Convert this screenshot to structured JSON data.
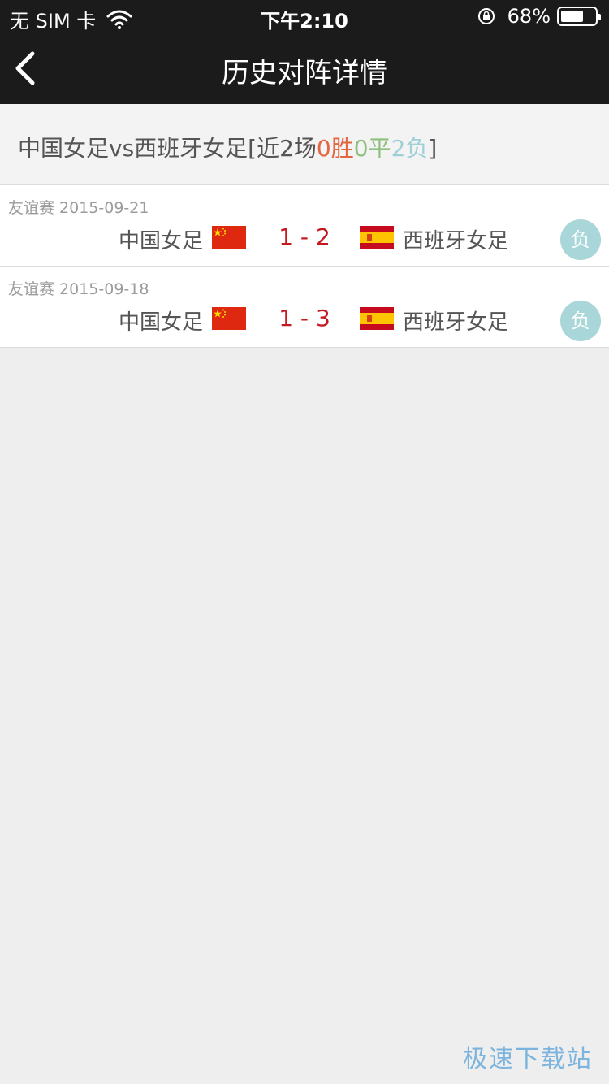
{
  "status_bar": {
    "carrier": "无 SIM 卡",
    "time": "下午2:10",
    "battery": "68%",
    "battery_level": 0.68
  },
  "header": {
    "title": "历史对阵详情"
  },
  "summary": {
    "matchup": "中国女足vs西班牙女足[近2场",
    "wins": "0胜",
    "draws": "0平",
    "losses": "2负",
    "close": "]"
  },
  "matches": [
    {
      "competition_date": "友谊赛 2015-09-21",
      "home": "中国女足",
      "score": "1 - 2",
      "away": "西班牙女足",
      "result": "负"
    },
    {
      "competition_date": "友谊赛 2015-09-18",
      "home": "中国女足",
      "score": "1 - 3",
      "away": "西班牙女足",
      "result": "负"
    }
  ],
  "watermark": "极速下载站",
  "colors": {
    "bar_bg": "#1b1b1b",
    "win": "#e2663f",
    "draw": "#8fbf7f",
    "loss": "#9fd0d6",
    "score": "#c3181e",
    "badge": "#a9d6d8"
  }
}
